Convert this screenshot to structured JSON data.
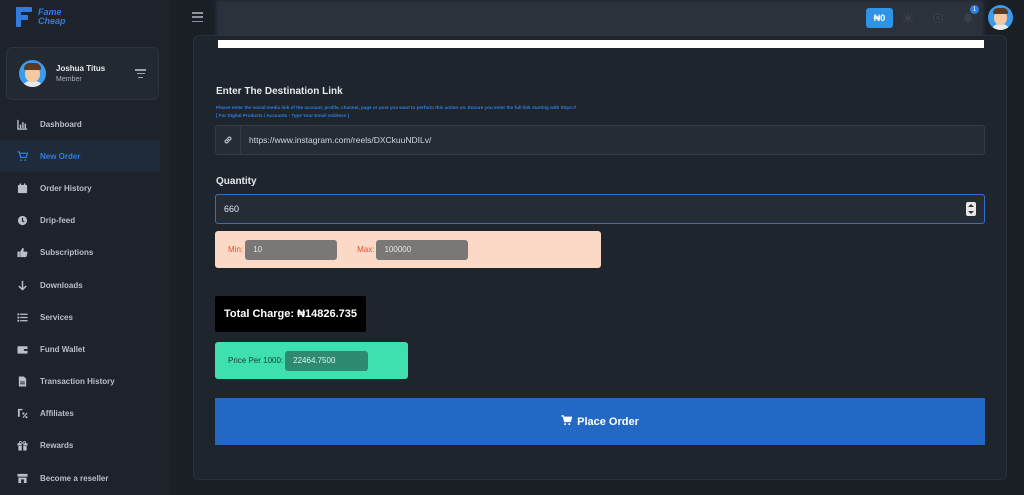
{
  "brand": {
    "line1": "Fame",
    "line2": "Cheap"
  },
  "profile": {
    "name": "Joshua Titus",
    "role": "Member"
  },
  "sidebar": {
    "items": [
      {
        "label": "Dashboard",
        "icon": "chart-bar-icon"
      },
      {
        "label": "New Order",
        "icon": "cart-icon",
        "active": true
      },
      {
        "label": "Order History",
        "icon": "calendar-icon"
      },
      {
        "label": "Drip-feed",
        "icon": "clock-icon"
      },
      {
        "label": "Subscriptions",
        "icon": "thumbs-up-icon"
      },
      {
        "label": "Downloads",
        "icon": "arrow-down-icon"
      },
      {
        "label": "Services",
        "icon": "list-icon"
      },
      {
        "label": "Fund Wallet",
        "icon": "wallet-icon"
      },
      {
        "label": "Transaction History",
        "icon": "file-icon"
      },
      {
        "label": "Affiliates",
        "icon": "percent-icon"
      },
      {
        "label": "Rewards",
        "icon": "gift-icon"
      },
      {
        "label": "Become a reseller",
        "icon": "store-icon"
      }
    ]
  },
  "topbar": {
    "balance": "₦0",
    "notification_count": "1"
  },
  "form": {
    "destination": {
      "title": "Enter The Destination Link",
      "help_line1": "Please enter the social media link of the account, profile, channel, page or post you want to perform this action on. Ensure you enter the full link starting with https://",
      "help_line2": "[ For Digital Products / Accounts - Type Your Email Address ]",
      "value": "https://www.instagram.com/reels/DXCkuuNDILv/"
    },
    "quantity": {
      "label": "Quantity",
      "value": "660",
      "min_label": "Min:",
      "min_value": "10",
      "max_label": "Max:",
      "max_value": "100000"
    },
    "total_charge": "Total Charge: ₦14826.735",
    "price_per_1000": {
      "label": "Price Per 1000:",
      "value": "22464.7500"
    },
    "submit_label": "Place Order"
  },
  "colors": {
    "accent": "#2f7de1",
    "button": "#2268c4",
    "sidebar_bg": "#1e232b",
    "page_bg": "#1a1f26"
  }
}
